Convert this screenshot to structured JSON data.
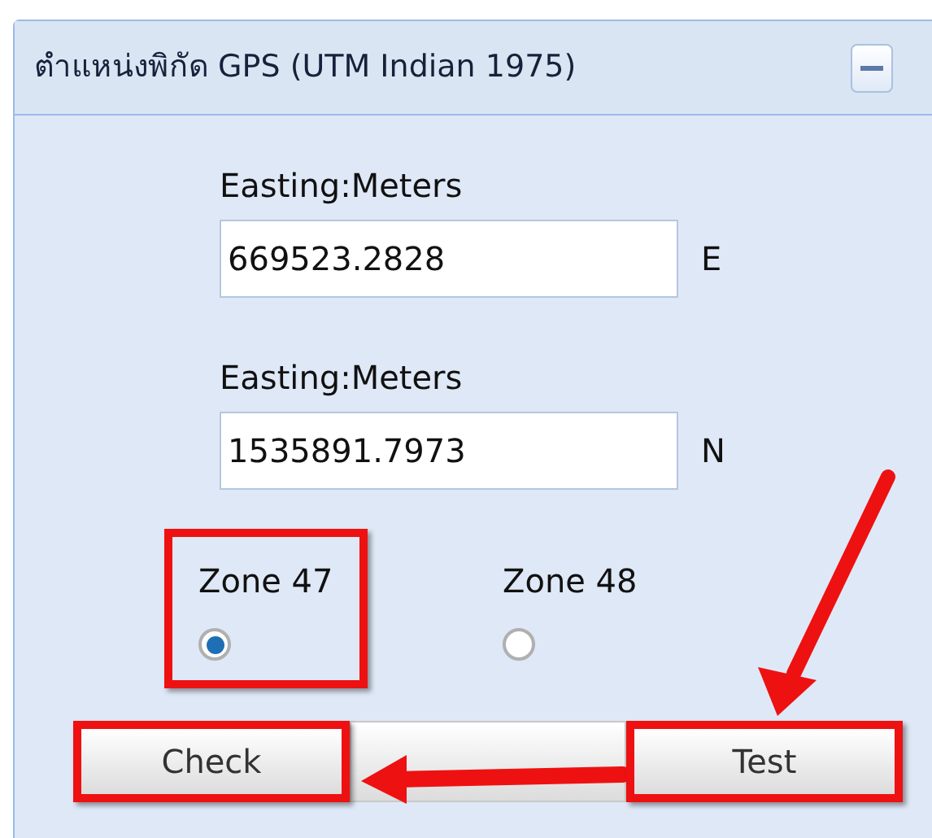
{
  "panel": {
    "title": "ตำแหน่งพิกัด GPS (UTM Indian 1975)"
  },
  "fields": [
    {
      "label": "Easting:Meters",
      "value": "669523.2828",
      "unit": "E"
    },
    {
      "label": "Easting:Meters",
      "value": "1535891.7973",
      "unit": "N"
    }
  ],
  "zones": [
    {
      "label": "Zone 47",
      "selected": true,
      "highlighted": true
    },
    {
      "label": "Zone 48",
      "selected": false,
      "highlighted": false
    }
  ],
  "buttons": [
    {
      "label": "Check",
      "highlighted": true
    },
    {
      "highlighted": false
    },
    {
      "label": "Test",
      "highlighted": true
    }
  ]
}
